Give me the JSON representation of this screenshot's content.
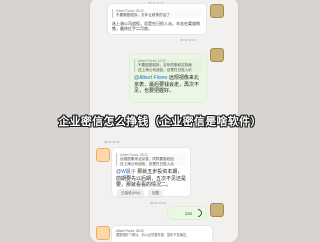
{
  "chat": {
    "timestamp_top": "08:32 11:20",
    "msg1": {
      "quote_title": "Albert Flores: 08:32",
      "quote_body": "不要赛股股拆，去年让政策的话了",
      "text": "选上海公司战役，总是在日投入派，辛苦在渠道销售，最终红手二月底。"
    },
    "timestamp_2": "08:32 11:20",
    "msg2": {
      "quote_title": "Albert Flores: 10:20",
      "quote_body": "不要蕴股股拆，去年的股权实际面",
      "quote_body2": "还上海公司战役，总是在日投入价",
      "mention": "@Albert Flores",
      "text": "远规视像来北京表，最后要钱会走，再次不见，也要把握好。"
    },
    "timestamp_3": "08:32 11:20",
    "msg3": {
      "quote_title": "Albert Flores: 08:32",
      "quote_body": "远规视像来北京表，同样要股权回",
      "quote_body2": "还上海公司战役，总是在日投入派",
      "mention": "@W晨子",
      "text": "那就五步投资本期，前期要先以后期，五次不见还是要，那就看看的情况二。"
    },
    "buttons": {
      "accept": "已接收(90s)",
      "cancel": "回复"
    },
    "timestamp_4": "08:32 11:20",
    "voice": {
      "duration": "12s"
    },
    "msg_bottom": {
      "quote_title": "Albert Flores: 08:32",
      "text": "要整理好个期功，前以必须要事做，整年不是确定。"
    }
  },
  "overlay": {
    "title": "企业密信怎么挣钱（企业密信是啥软件）"
  },
  "colors": {
    "background": "#d7d4cf",
    "bubble_green": "#e9f7e3",
    "mention_blue": "#2d6bb5"
  }
}
